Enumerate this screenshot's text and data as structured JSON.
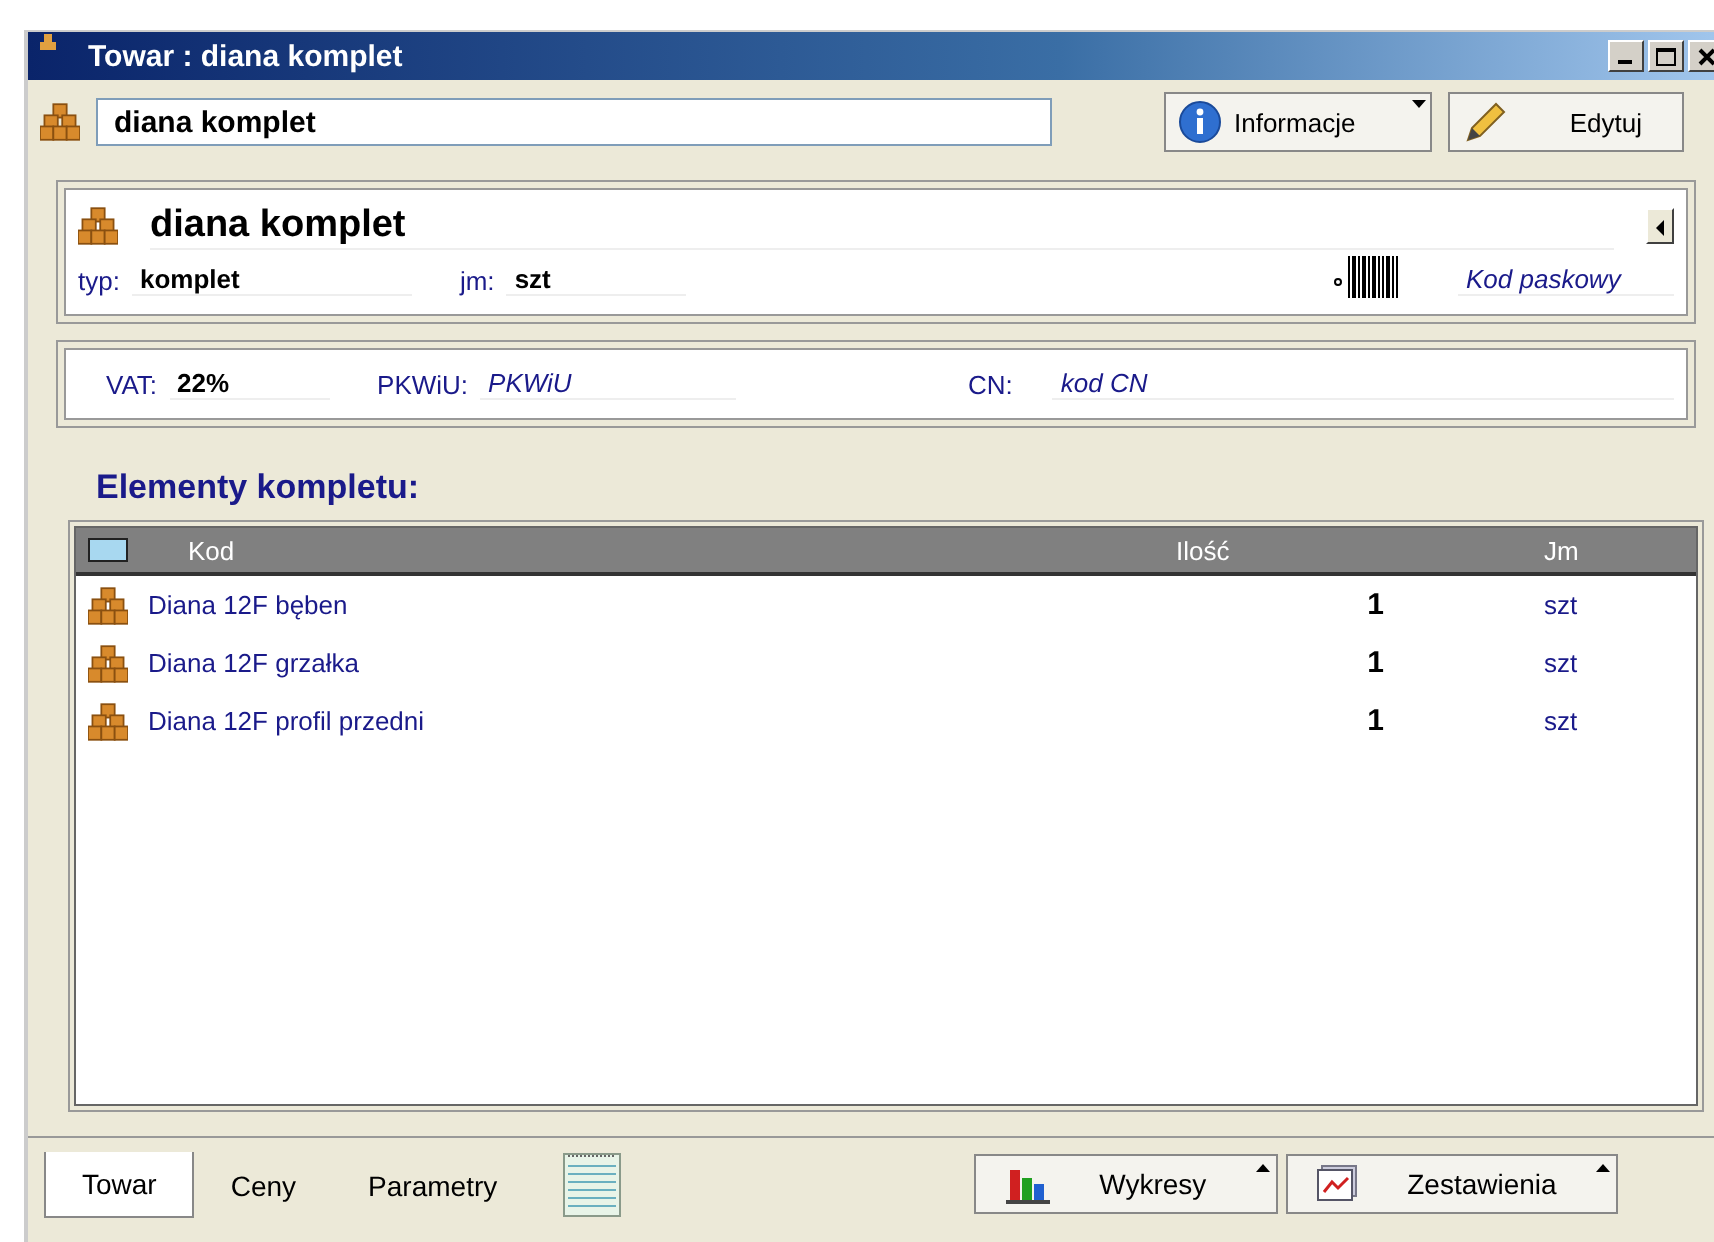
{
  "window": {
    "title": "Towar : diana komplet"
  },
  "toolbar": {
    "name_field": "diana komplet",
    "buttons": [
      "Informacje",
      "Edytuj"
    ]
  },
  "header": {
    "name": "diana komplet",
    "typ_label": "typ:",
    "typ": "komplet",
    "jm_label": "jm:",
    "jm": "szt",
    "barcode": "Kod paskowy"
  },
  "tax": {
    "vat_label": "VAT:",
    "vat": "22%",
    "pkwiu_label": "PKWiU:",
    "pkwiu": "PKWiU",
    "cn_label": "CN:",
    "cn": "kod CN"
  },
  "section_title": "Elementy kompletu:",
  "table": {
    "columns": [
      "Kod",
      "Ilość",
      "Jm"
    ],
    "rows": [
      {
        "kod": "Diana 12F bęben",
        "ilosc": "1",
        "jm": "szt"
      },
      {
        "kod": "Diana 12F grzałka",
        "ilosc": "1",
        "jm": "szt"
      },
      {
        "kod": "Diana 12F profil przedni",
        "ilosc": "1",
        "jm": "szt"
      }
    ]
  },
  "tabs": [
    {
      "label": "Towar",
      "selected": true
    },
    {
      "label": "Ceny",
      "selected": false
    },
    {
      "label": "Parametry",
      "selected": false
    }
  ],
  "bottom_buttons": [
    "Wykresy",
    "Zestawienia"
  ]
}
